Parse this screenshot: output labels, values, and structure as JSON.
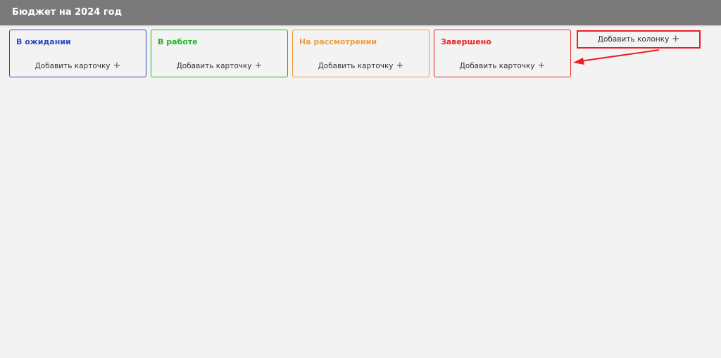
{
  "header": {
    "title": "Бюджет на 2024 год"
  },
  "columns": [
    {
      "title": "В ожидании",
      "add_card_label": "Добавить карточку",
      "color": "#3048c0"
    },
    {
      "title": "В работе",
      "add_card_label": "Добавить карточку",
      "color": "#1cb81c"
    },
    {
      "title": "На рассмотрении",
      "add_card_label": "Добавить карточку",
      "color": "#f59a3b"
    },
    {
      "title": "Завершено",
      "add_card_label": "Добавить карточку",
      "color": "#e52323"
    }
  ],
  "add_column": {
    "label": "Добавить колонку",
    "icon": "plus-icon",
    "highlight_color": "#ee1c24"
  },
  "icons": {
    "plus": "+"
  }
}
